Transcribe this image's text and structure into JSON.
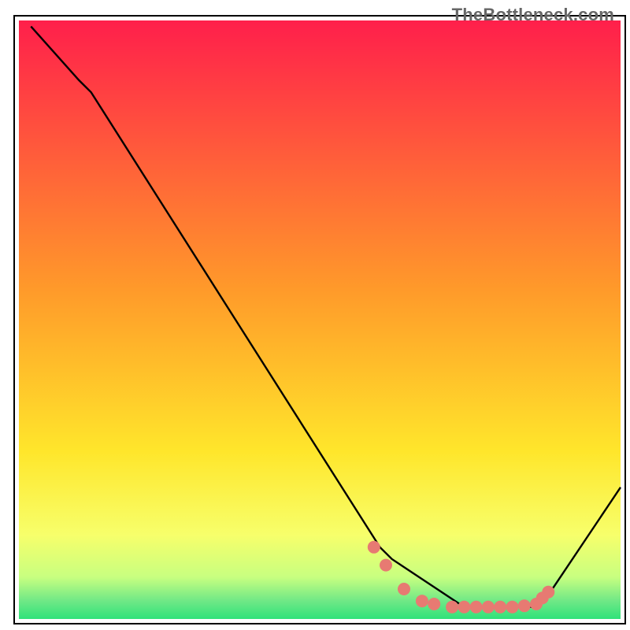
{
  "watermark": "TheBottleneck.com",
  "colors": {
    "gradient_top": "#ff1f4b",
    "gradient_mid_up": "#ff8a2a",
    "gradient_mid": "#ffe62b",
    "gradient_low": "#f7ff6b",
    "gradient_green_a": "#96ff7d",
    "gradient_green_b": "#2fe27a",
    "line": "#000000",
    "marker_fill": "#e77a72",
    "marker_stroke": "#8f3c36"
  },
  "chart_data": {
    "type": "line",
    "title": "",
    "xlabel": "",
    "ylabel": "",
    "xlim": [
      0,
      100
    ],
    "ylim": [
      0,
      100
    ],
    "series": [
      {
        "name": "curve",
        "x": [
          2,
          10,
          12,
          60,
          62,
          74,
          86,
          88,
          100
        ],
        "y": [
          99,
          90,
          88,
          12,
          10,
          2,
          2,
          4,
          22
        ]
      }
    ],
    "markers": {
      "name": "highlight-points",
      "x": [
        59,
        61,
        64,
        67,
        69,
        72,
        74,
        76,
        78,
        80,
        82,
        84,
        86,
        87,
        88
      ],
      "y": [
        12,
        9,
        5,
        3,
        2.5,
        2,
        2,
        2,
        2,
        2,
        2,
        2.2,
        2.5,
        3.5,
        4.5
      ]
    }
  }
}
